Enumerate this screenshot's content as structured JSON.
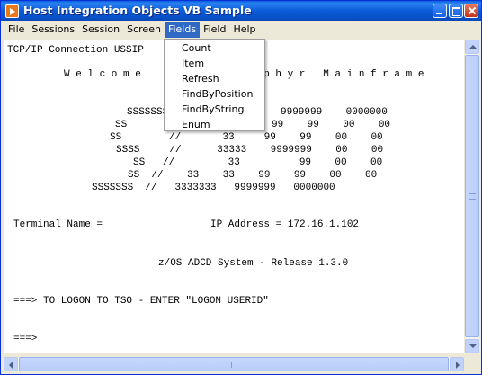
{
  "window": {
    "title": "Host Integration Objects VB Sample"
  },
  "menubar": {
    "items": [
      {
        "label": "File"
      },
      {
        "label": "Sessions"
      },
      {
        "label": "Session"
      },
      {
        "label": "Screen"
      },
      {
        "label": "Fields"
      },
      {
        "label": "Field"
      },
      {
        "label": "Help"
      }
    ],
    "active": "Fields"
  },
  "fields_menu": {
    "items": [
      {
        "label": "Count"
      },
      {
        "label": "Item"
      },
      {
        "label": "Refresh"
      },
      {
        "label": "FindByPosition"
      },
      {
        "label": "FindByString"
      },
      {
        "label": "Enum"
      }
    ]
  },
  "terminal": {
    "connection": "TCP/IP Connection USSIP",
    "welcome_left": "W e l c o m e",
    "welcome_right": "e p h y r   M a i n f r a m e",
    "logo_lines": [
      "SSSSSSS",
      "SS",
      "SS        //       33     99    99    00    00",
      "SSSS     //      33333    9999999    00    00",
      "SS   //         33          99    00    00",
      "SS  //    33    33    99    99    00    00",
      "SSSSSSS  //   3333333   9999999   0000000"
    ],
    "logo_line1_right": "9999999    0000000",
    "logo_line2_right": "99    99    00    00",
    "terminal_name_label": "Terminal Name =",
    "ip_address": "IP Address = 172.16.1.102",
    "system": "z/OS ADCD System - Release 1.3.0",
    "logon_prompt": "===> TO LOGON TO TSO - ENTER \"LOGON USERID\"",
    "prompt": "===>"
  }
}
